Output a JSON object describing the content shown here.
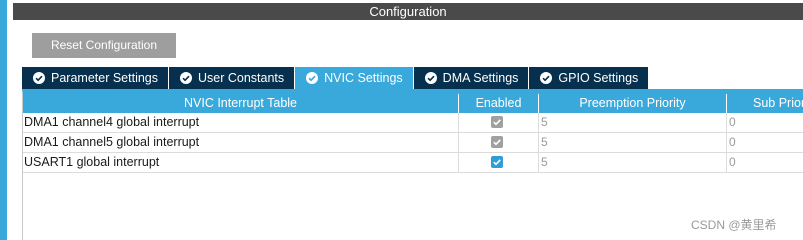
{
  "window": {
    "title": "Configuration"
  },
  "toolbar": {
    "reset_label": "Reset Configuration"
  },
  "tabs": [
    {
      "label": "Parameter Settings",
      "icon": "check-circle-icon",
      "active": false
    },
    {
      "label": "User Constants",
      "icon": "check-circle-icon",
      "active": false
    },
    {
      "label": "NVIC Settings",
      "icon": "check-circle-icon",
      "active": true
    },
    {
      "label": "DMA Settings",
      "icon": "check-circle-icon",
      "active": false
    },
    {
      "label": "GPIO Settings",
      "icon": "check-circle-icon",
      "active": false
    }
  ],
  "table": {
    "headers": [
      "NVIC Interrupt Table",
      "Enabled",
      "Preemption Priority",
      "Sub Priority"
    ],
    "rows": [
      {
        "name": "DMA1 channel4 global interrupt",
        "enabled": true,
        "enabled_style": "locked",
        "preemption": "5",
        "sub": "0"
      },
      {
        "name": "DMA1 channel5 global interrupt",
        "enabled": true,
        "enabled_style": "locked",
        "preemption": "5",
        "sub": "0"
      },
      {
        "name": "USART1 global interrupt",
        "enabled": true,
        "enabled_style": "editable",
        "preemption": "5",
        "sub": "0"
      }
    ]
  },
  "watermark": "CSDN @黄里希",
  "colors": {
    "accent": "#39a9dc",
    "tab_inactive": "#06304d",
    "title_bar": "#4a4a4a",
    "button": "#9e9e9e",
    "checkbox_locked": "#a0a0a0",
    "checkbox_editable": "#2f9ed6"
  }
}
